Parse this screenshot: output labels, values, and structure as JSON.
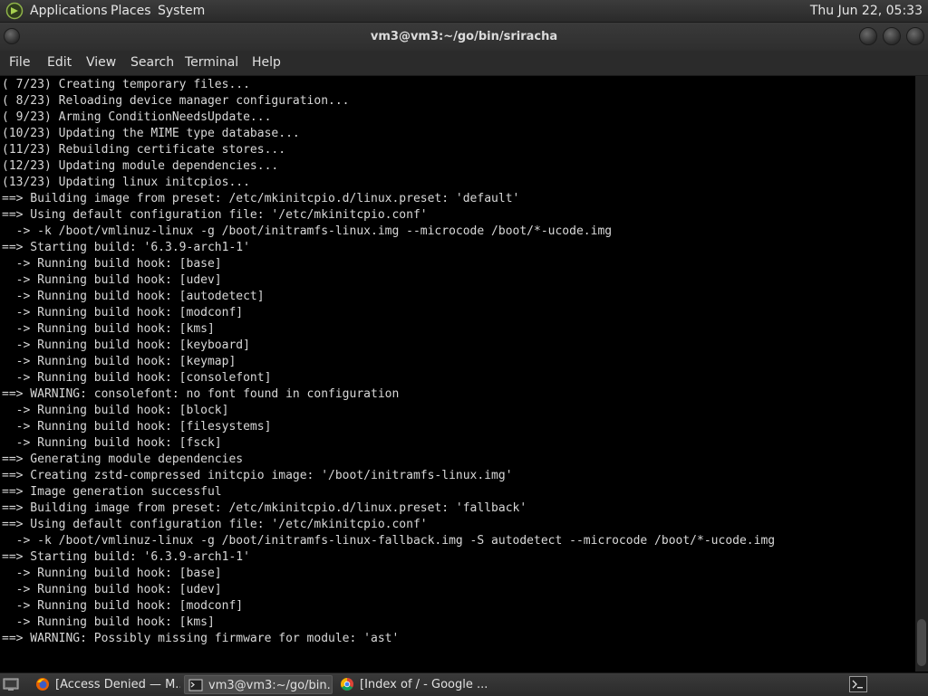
{
  "top_panel": {
    "menus": [
      "Applications",
      "Places",
      "System"
    ],
    "clock": "Thu Jun 22, 05:33"
  },
  "window": {
    "title": "vm3@vm3:~/go/bin/sriracha"
  },
  "menubar": [
    "File",
    "Edit",
    "View",
    "Search",
    "Terminal",
    "Help"
  ],
  "terminal": {
    "lines": [
      "( 7/23) Creating temporary files...",
      "( 8/23) Reloading device manager configuration...",
      "( 9/23) Arming ConditionNeedsUpdate...",
      "(10/23) Updating the MIME type database...",
      "(11/23) Rebuilding certificate stores...",
      "(12/23) Updating module dependencies...",
      "(13/23) Updating linux initcpios...",
      "==> Building image from preset: /etc/mkinitcpio.d/linux.preset: 'default'",
      "==> Using default configuration file: '/etc/mkinitcpio.conf'",
      "  -> -k /boot/vmlinuz-linux -g /boot/initramfs-linux.img --microcode /boot/*-ucode.img",
      "==> Starting build: '6.3.9-arch1-1'",
      "  -> Running build hook: [base]",
      "  -> Running build hook: [udev]",
      "  -> Running build hook: [autodetect]",
      "  -> Running build hook: [modconf]",
      "  -> Running build hook: [kms]",
      "  -> Running build hook: [keyboard]",
      "  -> Running build hook: [keymap]",
      "  -> Running build hook: [consolefont]",
      "==> WARNING: consolefont: no font found in configuration",
      "  -> Running build hook: [block]",
      "  -> Running build hook: [filesystems]",
      "  -> Running build hook: [fsck]",
      "==> Generating module dependencies",
      "==> Creating zstd-compressed initcpio image: '/boot/initramfs-linux.img'",
      "==> Image generation successful",
      "==> Building image from preset: /etc/mkinitcpio.d/linux.preset: 'fallback'",
      "==> Using default configuration file: '/etc/mkinitcpio.conf'",
      "  -> -k /boot/vmlinuz-linux -g /boot/initramfs-linux-fallback.img -S autodetect --microcode /boot/*-ucode.img",
      "==> Starting build: '6.3.9-arch1-1'",
      "  -> Running build hook: [base]",
      "  -> Running build hook: [udev]",
      "  -> Running build hook: [modconf]",
      "  -> Running build hook: [kms]",
      "==> WARNING: Possibly missing firmware for module: 'ast'"
    ]
  },
  "taskbar": {
    "tasks": [
      {
        "label": "[Access Denied — M...",
        "icon": "firefox-icon"
      },
      {
        "label": "vm3@vm3:~/go/bin...",
        "icon": "terminal-icon"
      },
      {
        "label": "[Index of / - Google ...",
        "icon": "chrome-icon"
      }
    ]
  },
  "colors": {
    "panel": "#2b2b2b",
    "terminal_bg": "#000000",
    "terminal_fg": "#d8d8d8"
  }
}
